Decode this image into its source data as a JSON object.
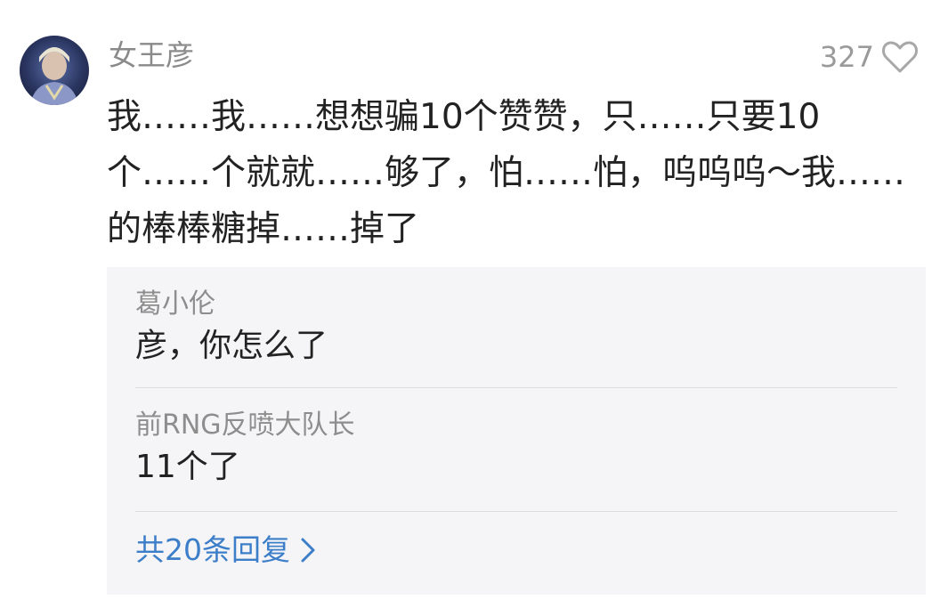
{
  "comment": {
    "username": "女王彦",
    "likes": "327",
    "text": "我……我……想想骗10个赞赞，只……只要10个……个就就……够了，怕……怕，呜呜呜～我……的棒棒糖掉……掉了"
  },
  "replies": [
    {
      "author": "葛小伦",
      "text": "彦，你怎么了"
    },
    {
      "author": "前RNG反喷大队长",
      "text": "11个了"
    }
  ],
  "more_replies": "共20条回复",
  "colors": {
    "link": "#3d7ec9",
    "meta": "#8d8d8d",
    "reply_bg": "#f5f5f7"
  }
}
